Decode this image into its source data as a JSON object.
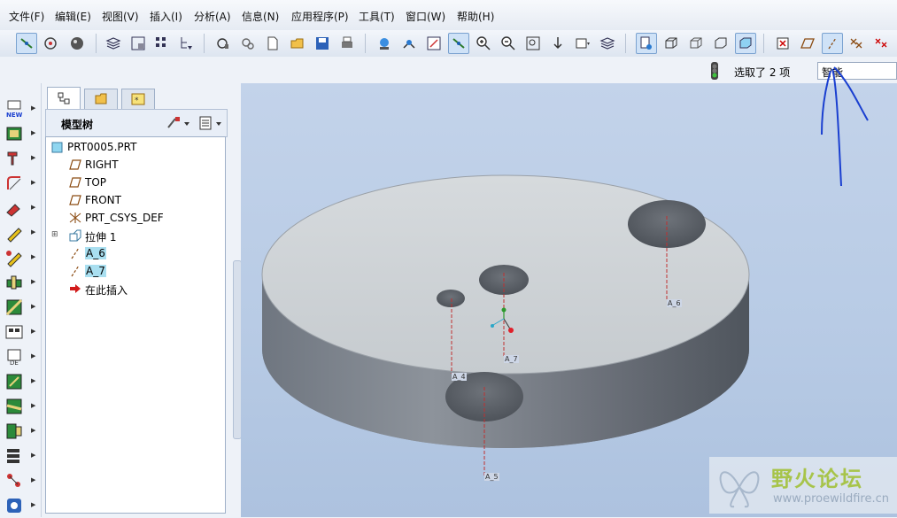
{
  "menu": [
    "文件(F)",
    "编辑(E)",
    "视图(V)",
    "插入(I)",
    "分析(A)",
    "信息(N)",
    "应用程序(P)",
    "工具(T)",
    "窗口(W)",
    "帮助(H)"
  ],
  "status": {
    "selected_text": "选取了 2 项",
    "filter_value": "智能"
  },
  "panel": {
    "title": "模型树"
  },
  "tree": {
    "items": [
      {
        "label": "PRT0005.PRT"
      },
      {
        "label": "RIGHT"
      },
      {
        "label": "TOP"
      },
      {
        "label": "FRONT"
      },
      {
        "label": "PRT_CSYS_DEF"
      },
      {
        "label": "拉伸 1"
      },
      {
        "label": "A_6"
      },
      {
        "label": "A_7"
      },
      {
        "label": "在此插入"
      }
    ]
  },
  "viewport": {
    "axis_labels": [
      "A_6",
      "A_7",
      "A_4",
      "A_5"
    ]
  },
  "watermark": {
    "title": "野火论坛",
    "url": "www.proewildfire.cn"
  },
  "colors": {
    "selection_highlight": "#a9dff0",
    "axis_line": "#c03030",
    "annotation": "#1a3fd0"
  }
}
